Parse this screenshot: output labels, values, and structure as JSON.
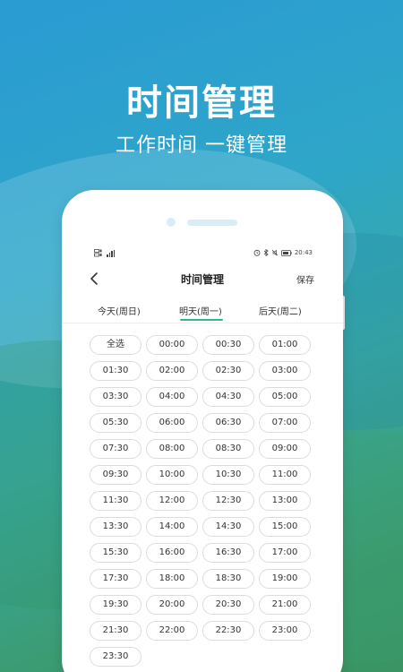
{
  "hero": {
    "title": "时间管理",
    "subtitle": "工作时间 一键管理"
  },
  "status_bar": {
    "left_icons": [
      "sim-card-icon",
      "signal-icon"
    ],
    "right_icons": [
      "alarm-icon",
      "bluetooth-icon",
      "mute-icon",
      "battery-icon"
    ],
    "time": "20:43"
  },
  "navbar": {
    "back_icon": "chevron-left-icon",
    "title": "时间管理",
    "save_label": "保存"
  },
  "tabs": [
    {
      "label": "今天(周日)",
      "active": false
    },
    {
      "label": "明天(周一)",
      "active": true
    },
    {
      "label": "后天(周二)",
      "active": false
    }
  ],
  "colors": {
    "accent": "#2fb88a",
    "background_top": "#2a9bd3",
    "background_bottom": "#3a9463"
  },
  "slots": [
    "全选",
    "00:00",
    "00:30",
    "01:00",
    "01:30",
    "02:00",
    "02:30",
    "03:00",
    "03:30",
    "04:00",
    "04:30",
    "05:00",
    "05:30",
    "06:00",
    "06:30",
    "07:00",
    "07:30",
    "08:00",
    "08:30",
    "09:00",
    "09:30",
    "10:00",
    "10:30",
    "11:00",
    "11:30",
    "12:00",
    "12:30",
    "13:00",
    "13:30",
    "14:00",
    "14:30",
    "15:00",
    "15:30",
    "16:00",
    "16:30",
    "17:00",
    "17:30",
    "18:00",
    "18:30",
    "19:00",
    "19:30",
    "20:00",
    "20:30",
    "21:00",
    "21:30",
    "22:00",
    "22:30",
    "23:00",
    "23:30"
  ]
}
